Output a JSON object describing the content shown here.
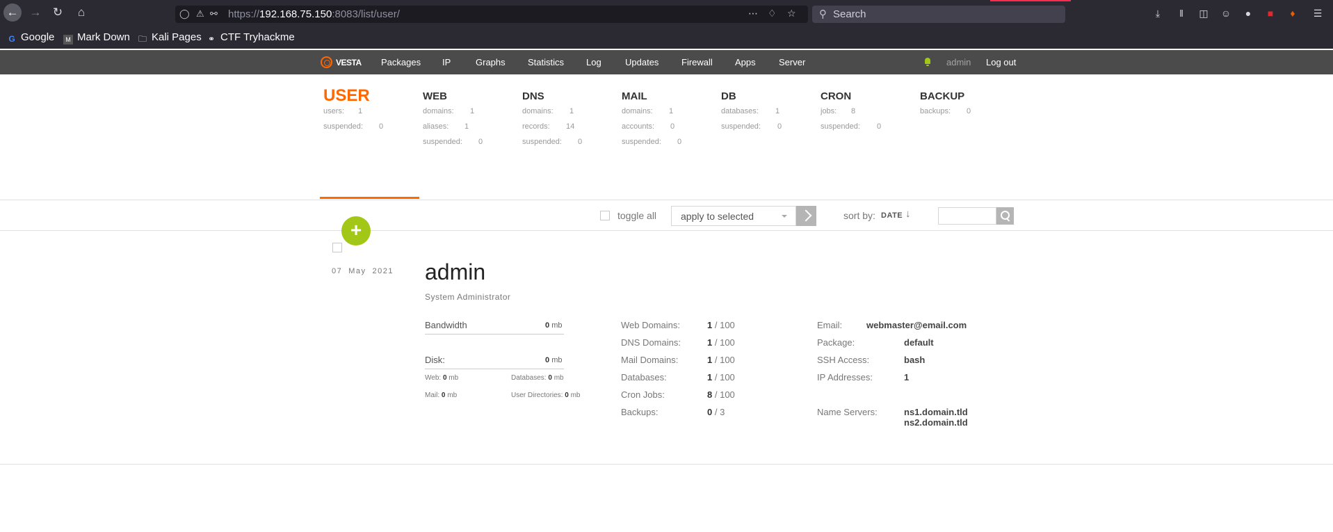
{
  "browser": {
    "url_protocol": "https://",
    "url_host": "192.168.75.150",
    "url_rest": ":8083/list/user/",
    "search_placeholder": "Search",
    "bookmarks": [
      "Google",
      "Mark Down",
      "Kali Pages",
      "CTF Tryhackme"
    ]
  },
  "topnav": {
    "logo": "VESTA",
    "items": [
      "Packages",
      "IP",
      "Graphs",
      "Statistics",
      "Log",
      "Updates",
      "Firewall",
      "Apps",
      "Server"
    ],
    "user": "admin",
    "logout": "Log out"
  },
  "tabs": [
    {
      "title": "USER",
      "stats": [
        {
          "label": "users:",
          "value": "1"
        },
        {
          "label": "suspended:",
          "value": "0"
        }
      ]
    },
    {
      "title": "WEB",
      "stats": [
        {
          "label": "domains:",
          "value": "1"
        },
        {
          "label": "aliases:",
          "value": "1"
        },
        {
          "label": "suspended:",
          "value": "0"
        }
      ]
    },
    {
      "title": "DNS",
      "stats": [
        {
          "label": "domains:",
          "value": "1"
        },
        {
          "label": "records:",
          "value": "14"
        },
        {
          "label": "suspended:",
          "value": "0"
        }
      ]
    },
    {
      "title": "MAIL",
      "stats": [
        {
          "label": "domains:",
          "value": "1"
        },
        {
          "label": "accounts:",
          "value": "0"
        },
        {
          "label": "suspended:",
          "value": "0"
        }
      ]
    },
    {
      "title": "DB",
      "stats": [
        {
          "label": "databases:",
          "value": "1"
        },
        {
          "label": "suspended:",
          "value": "0"
        }
      ]
    },
    {
      "title": "CRON",
      "stats": [
        {
          "label": "jobs:",
          "value": "8"
        },
        {
          "label": "suspended:",
          "value": "0"
        }
      ]
    },
    {
      "title": "BACKUP",
      "stats": [
        {
          "label": "backups:",
          "value": "0"
        }
      ]
    }
  ],
  "toolbar": {
    "toggle_all": "toggle all",
    "apply_select": "apply to selected",
    "sort_label": "sort by:",
    "sort_value": "DATE",
    "sort_arrow": "↓",
    "add_symbol": "+"
  },
  "user": {
    "date_day": "07",
    "date_month": "May",
    "date_year": "2021",
    "name": "admin",
    "fullname": "System Administrator",
    "bandwidth_label": "Bandwidth",
    "bandwidth_value": "0",
    "bandwidth_unit": "mb",
    "disk_label": "Disk:",
    "disk_value": "0",
    "disk_unit": "mb",
    "disk_sub": [
      {
        "label": "Web:",
        "value": "0",
        "unit": "mb"
      },
      {
        "label": "Databases:",
        "value": "0",
        "unit": "mb"
      },
      {
        "label": "Mail:",
        "value": "0",
        "unit": "mb"
      },
      {
        "label": "User Directories:",
        "value": "0",
        "unit": "mb"
      }
    ],
    "limits": [
      {
        "label": "Web Domains:",
        "used": "1",
        "total": "/ 100"
      },
      {
        "label": "DNS Domains:",
        "used": "1",
        "total": "/ 100"
      },
      {
        "label": "Mail Domains:",
        "used": "1",
        "total": "/ 100"
      },
      {
        "label": "Databases:",
        "used": "1",
        "total": "/ 100"
      },
      {
        "label": "Cron Jobs:",
        "used": "8",
        "total": "/ 100"
      },
      {
        "label": "Backups:",
        "used": "0",
        "total": "/ 3"
      }
    ],
    "info": {
      "email_label": "Email:",
      "email": "webmaster@email.com",
      "package_label": "Package:",
      "package": "default",
      "ssh_label": "SSH Access:",
      "ssh": "bash",
      "ip_label": "IP Addresses:",
      "ip": "1",
      "ns_label": "Name Servers:",
      "ns1": "ns1.domain.tld",
      "ns2": "ns2.domain.tld"
    }
  }
}
